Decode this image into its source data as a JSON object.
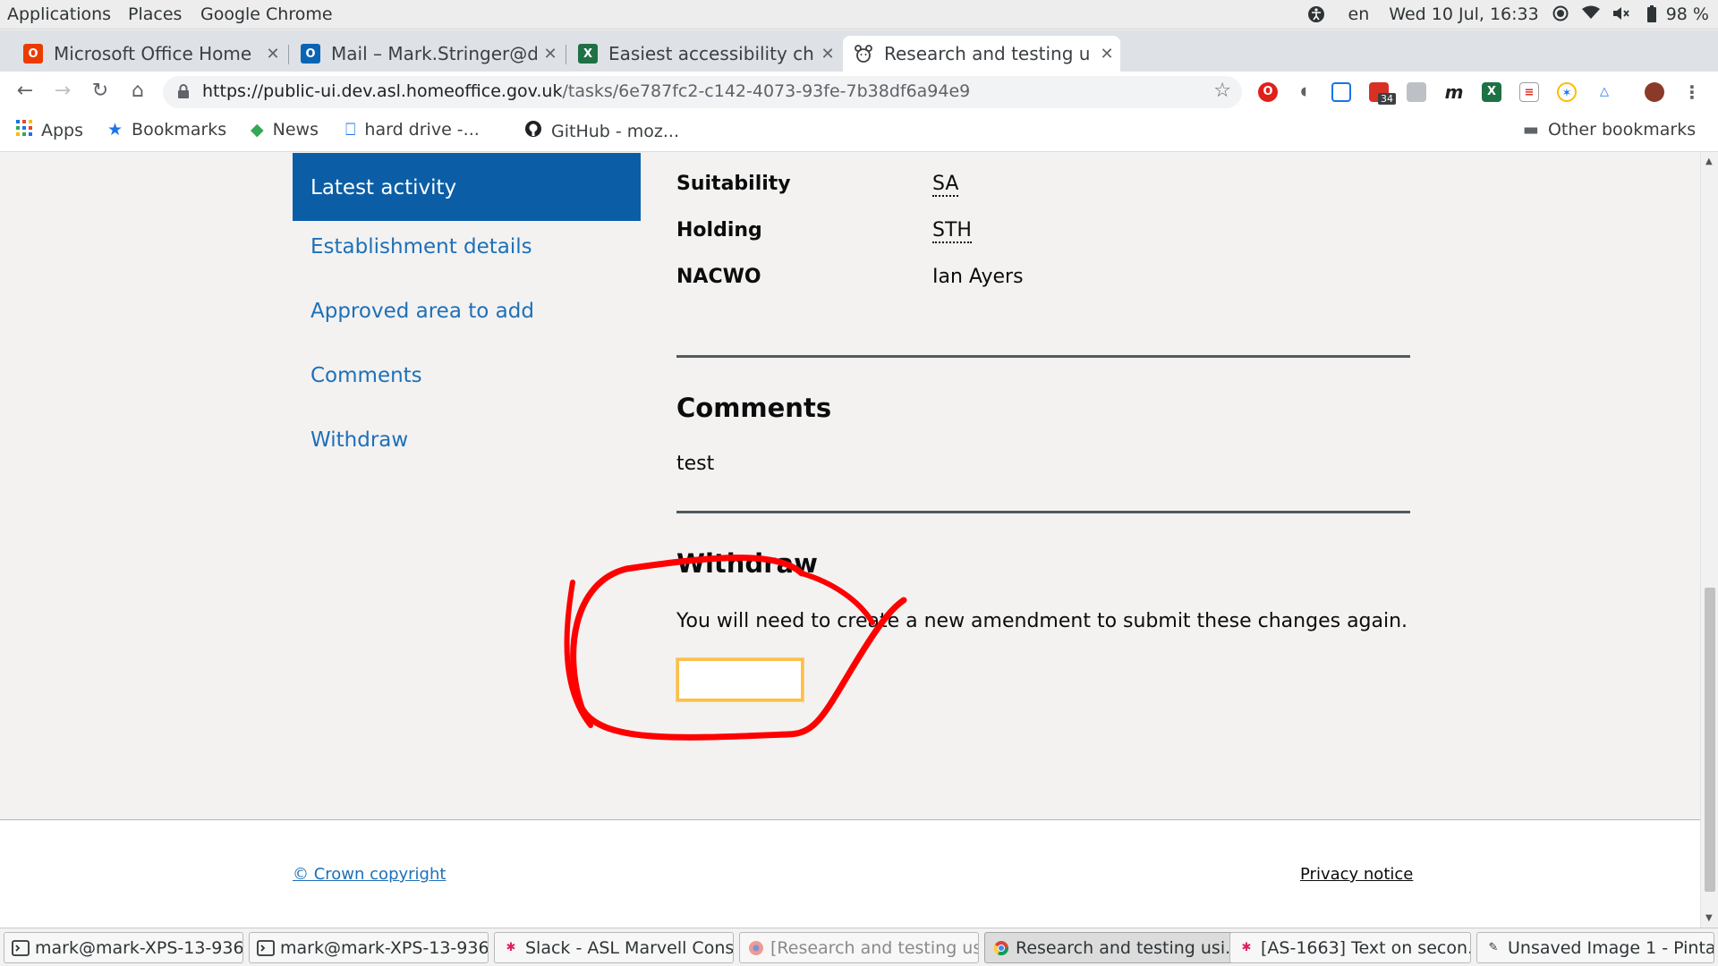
{
  "topbar": {
    "menus": [
      "Applications",
      "Places",
      "Google Chrome"
    ],
    "language": "en",
    "clock": "Wed 10 Jul, 16:33",
    "battery": "98 %"
  },
  "tabs": [
    {
      "label": "Microsoft Office Home",
      "icon": "office-icon",
      "color": "#eb3c00"
    },
    {
      "label": "Mail – Mark.Stringer@d",
      "icon": "outlook-icon",
      "color": "#0a64b4"
    },
    {
      "label": "Easiest accessibility ch",
      "icon": "excel-icon",
      "color": "#1e7145"
    },
    {
      "label": "Research and testing u",
      "icon": "animal-icon",
      "color": "#ffffff"
    }
  ],
  "address": {
    "host": "https://public-ui.dev.asl.homeoffice.gov.uk",
    "path": "/tasks/6e787fc2-c142-4073-93fe-7b38df6a94e9"
  },
  "extensions": {
    "badge_count": "34"
  },
  "bookmarks": {
    "apps": "Apps",
    "bookmarks": "Bookmarks",
    "news": "News",
    "hard_drive": "hard drive -...",
    "github": "GitHub - moz...",
    "other": "Other bookmarks"
  },
  "sidenav": {
    "active": "Latest activity",
    "links": [
      "Establishment details",
      "Approved area to add",
      "Comments",
      "Withdraw"
    ]
  },
  "details": {
    "rows": [
      {
        "term": "Suitability",
        "value": "SA"
      },
      {
        "term": "Holding",
        "value": "STH"
      },
      {
        "term": "NACWO",
        "value": "Ian Ayers"
      }
    ]
  },
  "comments": {
    "heading": "Comments",
    "text": "test"
  },
  "withdraw": {
    "heading": "Withdraw",
    "text": "You will need to create a new amendment to submit these changes again.",
    "button_label": ""
  },
  "footer": {
    "copyright": "© Crown copyright",
    "privacy": "Privacy notice"
  },
  "taskbar": [
    {
      "label": "mark@mark-XPS-13-936...",
      "icon": "terminal-icon"
    },
    {
      "label": "mark@mark-XPS-13-936...",
      "icon": "terminal-icon"
    },
    {
      "label": "Slack - ASL Marvell Cons...",
      "icon": "slack-icon"
    },
    {
      "label": "[Research and testing us...",
      "icon": "chrome-icon"
    },
    {
      "label": "Research and testing usi...",
      "icon": "chrome-icon"
    },
    {
      "label": "[AS-1663] Text on secon...",
      "icon": "slack-icon"
    },
    {
      "label": "Unsaved Image 1 - Pinta",
      "icon": "pinta-icon"
    }
  ],
  "colors": {
    "link": "#1d70b8",
    "nav_active": "#0b5ea6",
    "annotation": "#ff0000",
    "focus": "#ffbf47"
  }
}
